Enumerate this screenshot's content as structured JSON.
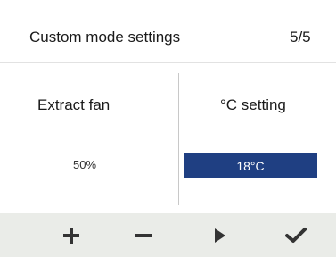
{
  "header": {
    "title": "Custom mode settings",
    "page_indicator": "5/5"
  },
  "left_column": {
    "label": "Extract fan",
    "value": "50%"
  },
  "right_column": {
    "label": "°C setting",
    "value": "18°C"
  },
  "toolbar": {
    "buttons": [
      {
        "name": "plus",
        "icon": "plus-icon"
      },
      {
        "name": "minus",
        "icon": "minus-icon"
      },
      {
        "name": "next",
        "icon": "play-icon"
      },
      {
        "name": "confirm",
        "icon": "checkmark-icon"
      }
    ]
  },
  "colors": {
    "selection": "#1f3f82",
    "toolbar_bg": "#eaece8",
    "icon": "#333333"
  }
}
